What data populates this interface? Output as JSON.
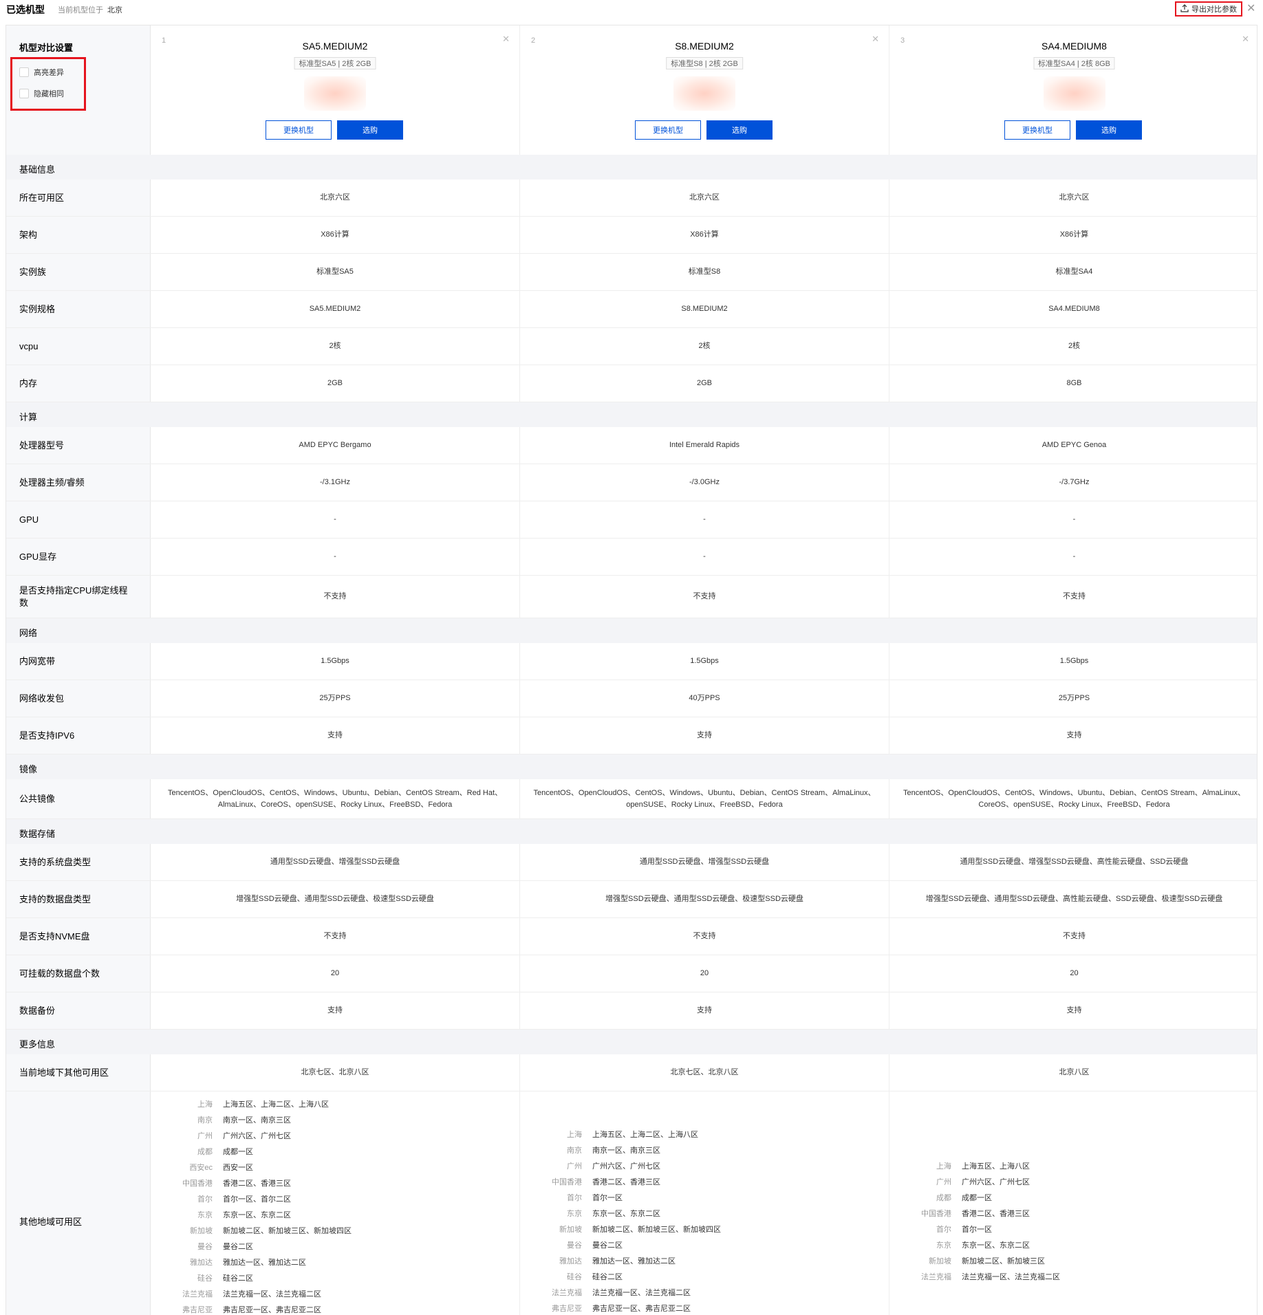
{
  "header": {
    "title": "已选机型",
    "location_label": "当前机型位于",
    "location_value": "北京",
    "export_label": "导出对比参数"
  },
  "colors": {
    "primary": "#0052d9",
    "highlight_border": "#e5141e",
    "label_bg": "#f7f8fa",
    "section_bg": "#f3f4f7"
  },
  "settings": {
    "title": "机型对比设置",
    "highlight_diff": "高亮差异",
    "hide_same": "隐藏相同"
  },
  "models": [
    {
      "index": "1",
      "name": "SA5.MEDIUM2",
      "spec": "标准型SA5 | 2核 2GB",
      "change_label": "更换机型",
      "buy_label": "选购"
    },
    {
      "index": "2",
      "name": "S8.MEDIUM2",
      "spec": "标准型S8 | 2核 2GB",
      "change_label": "更换机型",
      "buy_label": "选购"
    },
    {
      "index": "3",
      "name": "SA4.MEDIUM8",
      "spec": "标准型SA4 | 2核 8GB",
      "change_label": "更换机型",
      "buy_label": "选购"
    }
  ],
  "sections": [
    {
      "title": "基础信息",
      "rows": [
        {
          "label": "所在可用区",
          "values": [
            "北京六区",
            "北京六区",
            "北京六区"
          ]
        },
        {
          "label": "架构",
          "values": [
            "X86计算",
            "X86计算",
            "X86计算"
          ]
        },
        {
          "label": "实例族",
          "values": [
            "标准型SA5",
            "标准型S8",
            "标准型SA4"
          ]
        },
        {
          "label": "实例规格",
          "values": [
            "SA5.MEDIUM2",
            "S8.MEDIUM2",
            "SA4.MEDIUM8"
          ]
        },
        {
          "label": "vcpu",
          "values": [
            "2核",
            "2核",
            "2核"
          ]
        },
        {
          "label": "内存",
          "values": [
            "2GB",
            "2GB",
            "8GB"
          ]
        }
      ]
    },
    {
      "title": "计算",
      "rows": [
        {
          "label": "处理器型号",
          "values": [
            "AMD EPYC Bergamo",
            "Intel Emerald Rapids",
            "AMD EPYC Genoa"
          ]
        },
        {
          "label": "处理器主频/睿频",
          "values": [
            "-/3.1GHz",
            "-/3.0GHz",
            "-/3.7GHz"
          ]
        },
        {
          "label": "GPU",
          "values": [
            "-",
            "-",
            "-"
          ]
        },
        {
          "label": "GPU显存",
          "values": [
            "-",
            "-",
            "-"
          ]
        },
        {
          "label": "是否支持指定CPU绑定线程数",
          "values": [
            "不支持",
            "不支持",
            "不支持"
          ]
        }
      ]
    },
    {
      "title": "网络",
      "rows": [
        {
          "label": "内网宽带",
          "values": [
            "1.5Gbps",
            "1.5Gbps",
            "1.5Gbps"
          ]
        },
        {
          "label": "网络收发包",
          "values": [
            "25万PPS",
            "40万PPS",
            "25万PPS"
          ]
        },
        {
          "label": "是否支持IPV6",
          "values": [
            "支持",
            "支持",
            "支持"
          ]
        }
      ]
    },
    {
      "title": "镜像",
      "rows": [
        {
          "label": "公共镜像",
          "values": [
            "TencentOS、OpenCloudOS、CentOS、Windows、Ubuntu、Debian、CentOS Stream、Red Hat、AlmaLinux、CoreOS、openSUSE、Rocky Linux、FreeBSD、Fedora",
            "TencentOS、OpenCloudOS、CentOS、Windows、Ubuntu、Debian、CentOS Stream、AlmaLinux、openSUSE、Rocky Linux、FreeBSD、Fedora",
            "TencentOS、OpenCloudOS、CentOS、Windows、Ubuntu、Debian、CentOS Stream、AlmaLinux、CoreOS、openSUSE、Rocky Linux、FreeBSD、Fedora"
          ]
        }
      ]
    },
    {
      "title": "数据存储",
      "rows": [
        {
          "label": "支持的系统盘类型",
          "values": [
            "通用型SSD云硬盘、增强型SSD云硬盘",
            "通用型SSD云硬盘、增强型SSD云硬盘",
            "通用型SSD云硬盘、增强型SSD云硬盘、高性能云硬盘、SSD云硬盘"
          ]
        },
        {
          "label": "支持的数据盘类型",
          "values": [
            "增强型SSD云硬盘、通用型SSD云硬盘、极速型SSD云硬盘",
            "增强型SSD云硬盘、通用型SSD云硬盘、极速型SSD云硬盘",
            "增强型SSD云硬盘、通用型SSD云硬盘、高性能云硬盘、SSD云硬盘、极速型SSD云硬盘"
          ]
        },
        {
          "label": "是否支持NVME盘",
          "values": [
            "不支持",
            "不支持",
            "不支持"
          ]
        },
        {
          "label": "可挂载的数据盘个数",
          "values": [
            "20",
            "20",
            "20"
          ]
        },
        {
          "label": "数据备份",
          "values": [
            "支持",
            "支持",
            "支持"
          ]
        }
      ]
    },
    {
      "title": "更多信息",
      "rows": [
        {
          "label": "当前地域下其他可用区",
          "values": [
            "北京七区、北京八区",
            "北京七区、北京八区",
            "北京八区"
          ]
        }
      ]
    }
  ],
  "other_regions": {
    "label": "其他地域可用区",
    "columns": [
      [
        {
          "k": "上海",
          "v": "上海五区、上海二区、上海八区"
        },
        {
          "k": "南京",
          "v": "南京一区、南京三区"
        },
        {
          "k": "广州",
          "v": "广州六区、广州七区"
        },
        {
          "k": "成都",
          "v": "成都一区"
        },
        {
          "k": "西安ec",
          "v": "西安一区"
        },
        {
          "k": "中国香港",
          "v": "香港二区、香港三区"
        },
        {
          "k": "首尔",
          "v": "首尔一区、首尔二区"
        },
        {
          "k": "东京",
          "v": "东京一区、东京二区"
        },
        {
          "k": "新加坡",
          "v": "新加坡二区、新加坡三区、新加坡四区"
        },
        {
          "k": "曼谷",
          "v": "曼谷二区"
        },
        {
          "k": "雅加达",
          "v": "雅加达一区、雅加达二区"
        },
        {
          "k": "硅谷",
          "v": "硅谷二区"
        },
        {
          "k": "法兰克福",
          "v": "法兰克福一区、法兰克福二区"
        },
        {
          "k": "弗吉尼亚",
          "v": "弗吉尼亚一区、弗吉尼亚二区"
        }
      ],
      [
        {
          "k": "上海",
          "v": "上海五区、上海二区、上海八区"
        },
        {
          "k": "南京",
          "v": "南京一区、南京三区"
        },
        {
          "k": "广州",
          "v": "广州六区、广州七区"
        },
        {
          "k": "中国香港",
          "v": "香港二区、香港三区"
        },
        {
          "k": "首尔",
          "v": "首尔一区"
        },
        {
          "k": "东京",
          "v": "东京一区、东京二区"
        },
        {
          "k": "新加坡",
          "v": "新加坡二区、新加坡三区、新加坡四区"
        },
        {
          "k": "曼谷",
          "v": "曼谷二区"
        },
        {
          "k": "雅加达",
          "v": "雅加达一区、雅加达二区"
        },
        {
          "k": "硅谷",
          "v": "硅谷二区"
        },
        {
          "k": "法兰克福",
          "v": "法兰克福一区、法兰克福二区"
        },
        {
          "k": "弗吉尼亚",
          "v": "弗吉尼亚一区、弗吉尼亚二区"
        }
      ],
      [
        {
          "k": "上海",
          "v": "上海五区、上海八区"
        },
        {
          "k": "广州",
          "v": "广州六区、广州七区"
        },
        {
          "k": "成都",
          "v": "成都一区"
        },
        {
          "k": "中国香港",
          "v": "香港二区、香港三区"
        },
        {
          "k": "首尔",
          "v": "首尔一区"
        },
        {
          "k": "东京",
          "v": "东京一区、东京二区"
        },
        {
          "k": "新加坡",
          "v": "新加坡二区、新加坡三区"
        },
        {
          "k": "法兰克福",
          "v": "法兰克福一区、法兰克福二区"
        }
      ]
    ]
  }
}
